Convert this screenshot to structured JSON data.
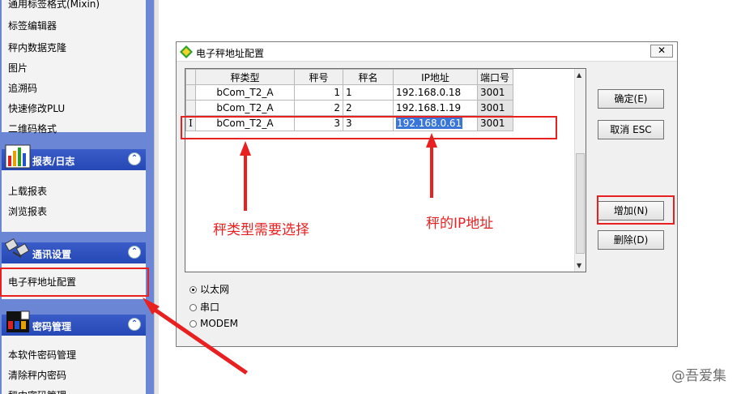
{
  "sidebar": {
    "top_items": [
      "通用标签格式(Mixin)",
      "标签编辑器",
      "秤内数据克隆",
      "图片",
      "追溯码",
      "快速修改PLU",
      "二维码格式"
    ],
    "report_panel": {
      "title": "报表/日志",
      "items": [
        "上载报表",
        "浏览报表"
      ]
    },
    "comm_panel": {
      "title": "通讯设置",
      "items": [
        "电子秤地址配置"
      ]
    },
    "password_panel": {
      "title": "密码管理",
      "items": [
        "本软件密码管理",
        "清除秤内密码",
        "秤内密码管理"
      ]
    },
    "collapse_glyph": "⌃"
  },
  "dialog": {
    "title": "电子秤地址配置",
    "close_glyph": "✕",
    "columns": [
      "秤类型",
      "秤号",
      "秤名",
      "IP地址",
      "端口号"
    ],
    "rows": [
      {
        "type": "bCom_T2_A",
        "no": "1",
        "name": "1",
        "ip": "192.168.0.18",
        "port": "3001"
      },
      {
        "type": "bCom_T2_A",
        "no": "2",
        "name": "2",
        "ip": "192.168.1.19",
        "port": "3001"
      },
      {
        "type": "bCom_T2_A",
        "no": "3",
        "name": "3",
        "ip": "192.168.0.61",
        "port": "3001",
        "indicator": "I"
      }
    ],
    "buttons": {
      "ok": "确定(E)",
      "cancel": "取消 ESC",
      "add": "增加(N)",
      "delete": "删除(D)"
    },
    "radios": {
      "ethernet": "以太网",
      "serial": "串口",
      "modem": "MODEM",
      "selected": "以太网"
    }
  },
  "annotations": {
    "type_note": "秤类型需要选择",
    "ip_note": "秤的IP地址"
  },
  "watermark": "@吾爱集"
}
